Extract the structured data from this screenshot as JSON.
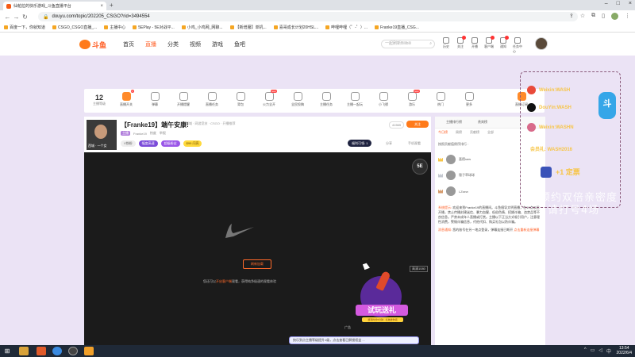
{
  "browser": {
    "tab_title": "仙帕拉的快乐游戏_斗鱼直播平台",
    "url": "douyu.com/topic/202205_CSGO?rid=3494554",
    "bookmarks": [
      "百度一下，你就知道",
      "CSGO_CSGO直播_...",
      "主播中心",
      "5EPlay - 5E对战平...",
      "小鸡_小鸡网_网聊...",
      "【新增服】单机...",
      "喜哥成长计划20HSL...",
      "哔哩哔哩（゜-゜）...",
      "Franke19直播_CSG..."
    ]
  },
  "header": {
    "logo_text": "斗鱼",
    "nav": [
      "首页",
      "直播",
      "分类",
      "视频",
      "游戏",
      "鱼吧"
    ],
    "search_placeholder": "一起刷新Bilibili",
    "icons": [
      {
        "label": "历史"
      },
      {
        "label": "关注",
        "badge": "9"
      },
      {
        "label": "开播"
      },
      {
        "label": "客户端",
        "badge": "9"
      },
      {
        "label": "通知",
        "badge": "5"
      },
      {
        "label": "任务中心"
      }
    ]
  },
  "actionbar": {
    "level_num": "12",
    "level_label": "主播等级",
    "items": [
      "直播开关",
      "弹幕",
      "开播提醒",
      "直播任务",
      "背包",
      "火力全开",
      "全民投稿",
      "主播任务",
      "主播一起玩",
      "小飞镖",
      "游乐",
      "热门",
      "更多"
    ],
    "right_label": "直播订阅"
  },
  "room": {
    "title": "【Franke19】端午安康!",
    "category_tags": "领域 · 网游竞技 · CSGO · 开播推荐",
    "tag": "主播",
    "streamer_name": "Franke19",
    "hot_label": "热度",
    "report": "举报",
    "badges": [
      "V铁粉",
      "幅度高速",
      "超级粉丝",
      "$99 闪亮"
    ],
    "count": "41565",
    "follow": "关注",
    "ep_label": "福利可领: 1",
    "share": "分享",
    "mobile": "手机观看",
    "avatar_caption": "西城 · 一个女"
  },
  "player": {
    "logo": "5E",
    "refresh": "刷新加载",
    "hint_prefix": "您还可以",
    "hint_highlight": "开启客户端",
    "hint_suffix": "观看，获得纯净极速的观看体验",
    "quality": "高清1080",
    "ad": "广告",
    "promo_title": "试玩送礼",
    "promo_sub": "游戏时长5分钟 · 礼物送你领"
  },
  "bottom_tip": "快乐到点主播等级提升1级，点击查看已解锁权益 ...",
  "chat": {
    "top_left": "主播排行榜",
    "top_right": "贵宾榜",
    "tabs": [
      "今日榜",
      "周榜",
      "贡献榜",
      "全部"
    ],
    "rank_title": "按照贡献值倒序排行",
    "rows": [
      {
        "name": "喜德saw"
      },
      {
        "name": "锤子草球球"
      },
      {
        "name": "LZsew"
      }
    ],
    "sys_label": "系统提示:",
    "sys_text": "欢迎来到Franke19的直播间。斗鱼倡导文明直播，在19点以后开播，禁止传播封建迷信、暴力血腥、低俗色情、招嫖诈骗、违禁品等不良信息。严禁未成年人直播或打赏。主播以下正当方式吸引用户，注意理性消费，警惕诈骗信息，代他代扣、购买礼包以防诈骗。",
    "notice_label": "消息通知:",
    "notice_text": "您的账号在另一地点登录，弹幕连接已断开",
    "notice_link": "点击重新连接弹幕"
  },
  "overlay": {
    "rows": [
      "Weixin:WASH",
      "DouYin:WASH",
      "Weixin:WASHN"
    ],
    "vip_label": "会员礼: WASH2016",
    "plus": "+1 定票",
    "mascot": "斗",
    "big_line1": "预约双倍亲密度",
    "big_line2": "请打号4场"
  },
  "taskbar": {
    "time": "13:54",
    "date": "2022/6/4"
  }
}
